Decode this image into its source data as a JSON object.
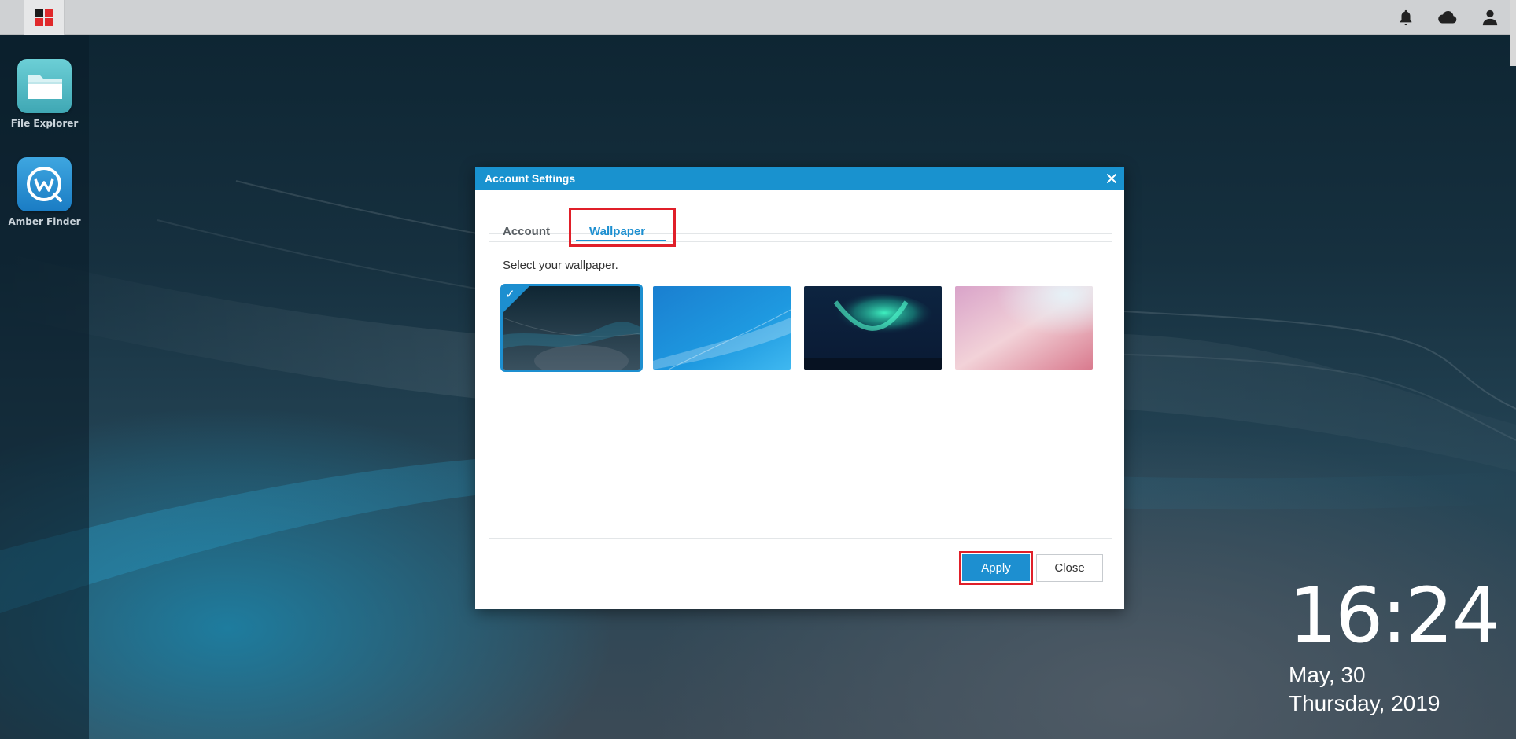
{
  "topbar": {
    "start_icon": "app-grid-icon",
    "icons": [
      "bell-icon",
      "cloud-icon",
      "user-icon"
    ]
  },
  "dock": {
    "apps": [
      {
        "label": "File Explorer",
        "icon": "folder-icon"
      },
      {
        "label": "Amber Finder",
        "icon": "amber-finder-icon"
      }
    ]
  },
  "dialog": {
    "title": "Account Settings",
    "tabs": [
      {
        "label": "Account",
        "active": false
      },
      {
        "label": "Wallpaper",
        "active": true
      }
    ],
    "prompt": "Select your wallpaper.",
    "wallpapers": [
      {
        "name": "dark-wave",
        "selected": true
      },
      {
        "name": "blue-wave",
        "selected": false
      },
      {
        "name": "aurora",
        "selected": false
      },
      {
        "name": "pink-gradient",
        "selected": false
      }
    ],
    "apply_label": "Apply",
    "close_label": "Close"
  },
  "clock": {
    "time": "16:24",
    "date": "May, 30",
    "day": "Thursday, 2019"
  },
  "colors": {
    "accent": "#1d8fd0",
    "dialog_header": "#1992cf",
    "highlight": "#e01f29"
  }
}
